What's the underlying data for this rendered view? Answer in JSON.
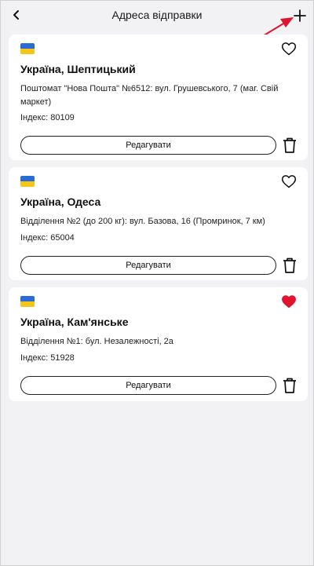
{
  "header": {
    "title": "Адреса відправки",
    "back_icon": "chevron-left-icon",
    "add_icon": "plus-icon"
  },
  "colors": {
    "background": "#f2f2f4",
    "card": "#ffffff",
    "favorite_active": "#e0142f",
    "annotation_arrow": "#e0142f",
    "flag_blue": "#2a6bd4",
    "flag_yellow": "#f5c518"
  },
  "addresses": [
    {
      "city": "Україна, Шептицький",
      "address": "Поштомат \"Нова Пошта\" №6512: вул. Грушевського, 7 (маг. Свій маркет)",
      "postcode": "Індекс: 80109",
      "favorite": false,
      "edit_label": "Редагувати"
    },
    {
      "city": "Україна, Одеса",
      "address": "Відділення №2 (до 200 кг): вул. Базова, 16 (Промринок, 7 км)",
      "postcode": "Індекс: 65004",
      "favorite": false,
      "edit_label": "Редагувати"
    },
    {
      "city": "Україна, Кам'янське",
      "address": "Відділення №1: бул. Незалежності, 2а",
      "postcode": "Індекс: 51928",
      "favorite": true,
      "edit_label": "Редагувати"
    }
  ]
}
